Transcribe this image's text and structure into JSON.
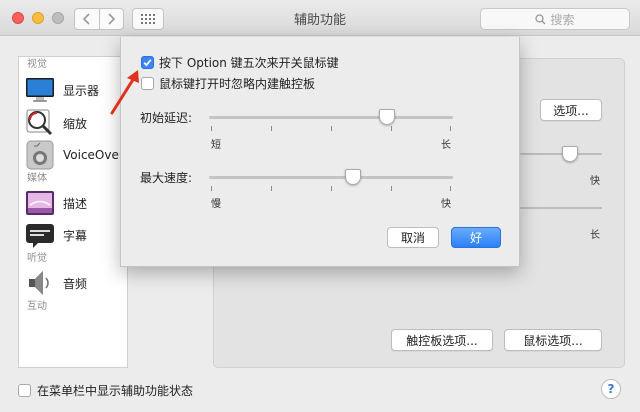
{
  "window": {
    "title": "辅助功能",
    "search_placeholder": "搜索"
  },
  "sidebar": {
    "sections": [
      {
        "label": "视觉"
      },
      {
        "label": "媒体"
      },
      {
        "label": "听觉"
      },
      {
        "label": "互动"
      }
    ],
    "items": [
      {
        "label": "显示器",
        "icon": "display-icon"
      },
      {
        "label": "缩放",
        "icon": "zoom-icon"
      },
      {
        "label": "VoiceOver",
        "icon": "voiceover-icon"
      },
      {
        "label": "描述",
        "icon": "descriptions-icon"
      },
      {
        "label": "字幕",
        "icon": "captions-icon"
      },
      {
        "label": "音频",
        "icon": "audio-icon"
      }
    ]
  },
  "main": {
    "options_button": "选项...",
    "trackpad_options_button": "触控板选项...",
    "mouse_options_button": "鼠标选项...",
    "slider_fast_label": "快",
    "slider_long_label": "长"
  },
  "dialog": {
    "option_toggle": {
      "label": "按下 Option 键五次来开关鼠标键",
      "checked": true
    },
    "ignore_trackpad": {
      "label": "鼠标键打开时忽略内建触控板",
      "checked": false
    },
    "initial_delay": {
      "label": "初始延迟:",
      "min_label": "短",
      "max_label": "长",
      "value": 0.73
    },
    "max_speed": {
      "label": "最大速度:",
      "min_label": "慢",
      "max_label": "快",
      "value": 0.59
    },
    "cancel_button": "取消",
    "ok_button": "好"
  },
  "footer": {
    "show_in_menu_bar": {
      "label": "在菜单栏中显示辅助功能状态",
      "checked": false
    },
    "help_button": "?"
  },
  "colors": {
    "accent": "#3b84f5",
    "annotation_arrow": "#e0301e"
  }
}
